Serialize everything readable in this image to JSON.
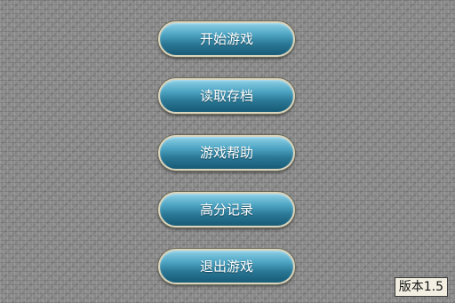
{
  "menu": {
    "buttons": [
      {
        "label": "开始游戏"
      },
      {
        "label": "读取存档"
      },
      {
        "label": "游戏帮助"
      },
      {
        "label": "高分记录"
      },
      {
        "label": "退出游戏"
      }
    ]
  },
  "footer": {
    "version": "版本1.5"
  },
  "colors": {
    "button_top": "#8fd0e6",
    "button_bottom": "#175a76",
    "button_border": "#d9d4bd",
    "background": "#8a8a8a"
  }
}
